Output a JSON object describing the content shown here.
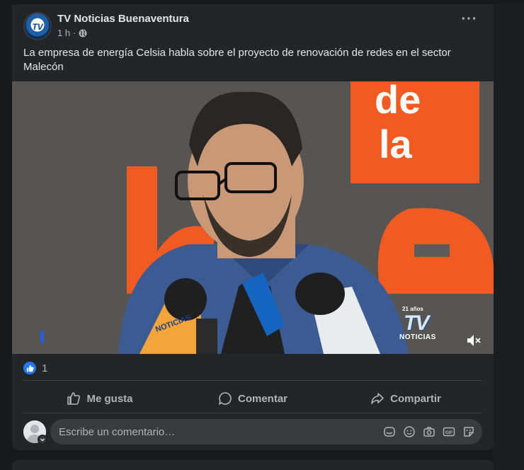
{
  "post": {
    "page_name": "TV Noticias Buenaventura",
    "time": "1 h",
    "separator": "·",
    "avatar_logo_text": "TV",
    "text": "La empresa de energía Celsia habla sobre el proyecto de renovación de redes en el sector Malecón"
  },
  "video": {
    "sign_text_1": "de",
    "sign_text_2": "la",
    "watermark_years": "21 años",
    "watermark_logo": "TV",
    "watermark_label": "NOTICIAS",
    "mic_label": "NOTICIAS"
  },
  "reactions": {
    "like_count": "1"
  },
  "actions": {
    "like": "Me gusta",
    "comment": "Comentar",
    "share": "Compartir"
  },
  "comment_box": {
    "placeholder": "Escribe un comentario…"
  },
  "colors": {
    "card_bg": "#242526",
    "page_bg": "#18191a",
    "like_blue": "#2078f4",
    "sign_orange": "#f15a22"
  }
}
